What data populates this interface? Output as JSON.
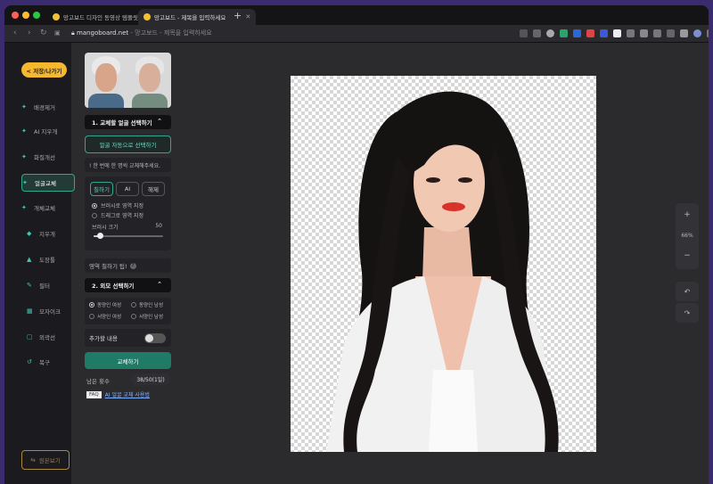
{
  "browser": {
    "tabs": [
      {
        "title": "망고보드 디자인 동영상 템플릿",
        "active": false
      },
      {
        "title": "망고보드 - 제목을 입력하세요",
        "active": true
      }
    ],
    "new_tab_label": "+",
    "url_host": "mangoboard.net",
    "url_page_title": "망고보드 - 제목을 입력하세요"
  },
  "sidebar": {
    "save_label": "< 저장/나가기",
    "items": [
      {
        "label": "배경제거",
        "icon": "sparkle-icon"
      },
      {
        "label": "AI 지우개",
        "icon": "sparkle-icon"
      },
      {
        "label": "화질개선",
        "icon": "sparkle-icon"
      },
      {
        "label": "얼굴교체",
        "icon": "sparkle-icon",
        "active": true
      },
      {
        "label": "개체교체",
        "icon": "sparkle-icon"
      },
      {
        "label": "지우개",
        "icon": "eraser-icon"
      },
      {
        "label": "도장툴",
        "icon": "stamp-icon"
      },
      {
        "label": "필터",
        "icon": "filter-icon"
      },
      {
        "label": "모자이크",
        "icon": "mosaic-icon"
      },
      {
        "label": "외곽선",
        "icon": "outline-icon"
      },
      {
        "label": "복구",
        "icon": "restore-icon"
      }
    ],
    "original_label": "원본보기"
  },
  "panel": {
    "section1_title": "1. 교체할 얼굴 선택하기",
    "auto_select_label": "얼굴 자동으로 선택하기",
    "notice": "! 한 번에 한 명씩 교체해주세요.",
    "tools": [
      "칠하기",
      "AI",
      "해제"
    ],
    "brush_option": "브러시로 영역 지정",
    "drag_option": "드래그로 영역 지정",
    "brush_size_label": "브러시 크기",
    "brush_size_value": "50",
    "brush_size_fraction": 0.1,
    "tip_label": "영역 칠하기 팁!",
    "tip_icon": "?",
    "section2_title": "2. 외모 선택하기",
    "appearance_options": [
      "동양인 여성",
      "동양인 남성",
      "서양인 여성",
      "서양인 남성"
    ],
    "extra_label": "추가할 내용",
    "replace_label": "교체하기",
    "remaining_label": "남은 횟수",
    "remaining_value": "38/50(1일)",
    "faq_tag": "FAQ",
    "faq_link": "AI 얼굴 교체 사용법"
  },
  "workspace": {
    "zoom_in": "+",
    "zoom_level": "66%",
    "zoom_out": "−",
    "undo_icon": "undo-icon",
    "redo_icon": "redo-icon"
  },
  "colors": {
    "accent": "#2fa88f",
    "save_button": "#f5b82e",
    "replace_button": "#1f7a66"
  }
}
